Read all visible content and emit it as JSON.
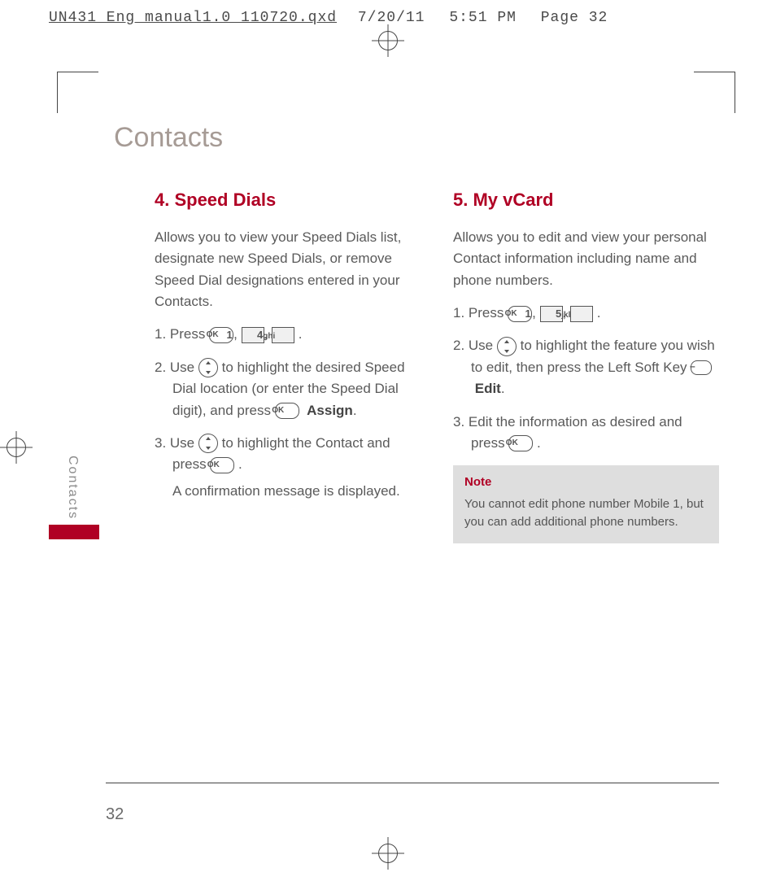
{
  "print_header": {
    "filename": "UN431_Eng_manual1.0_110720.qxd",
    "date": "7/20/11",
    "time": "5:51 PM",
    "page_label": "Page 32"
  },
  "chapter": "Contacts",
  "side_tab": "Contacts",
  "page_number": "32",
  "left": {
    "title": "4. Speed Dials",
    "intro": "Allows you to view your Speed Dials list, designate new Speed Dials, or remove Speed Dial designations entered in your Contacts.",
    "step1_pre": "1. Press ",
    "ok": "OK",
    "key1": "1",
    "key4": "4",
    "key4_sub": "ghi",
    "comma": ", ",
    "period": " .",
    "step2_pre": "2. Use ",
    "step2_post": " to highlight the desired Speed Dial location (or enter the Speed Dial digit), and press ",
    "assign": "Assign",
    "step3_pre": "3. Use ",
    "step3_mid": " to highlight the Contact and press ",
    "step3_tail": " .",
    "step3_after": "A confirmation message is displayed."
  },
  "right": {
    "title": "5. My vCard",
    "intro": "Allows you to edit and view your personal Contact information including name and phone numbers.",
    "step1_pre": "1. Press ",
    "key5": "5",
    "key5_sub": "jkl",
    "step2_pre": "2. Use ",
    "step2_post": " to highlight the feature you wish to edit, then press the Left Soft Key ",
    "softkey": "–",
    "edit": "Edit",
    "step3_pre": "3. Edit the information as desired and press ",
    "note_label": "Note",
    "note_body": "You cannot edit phone number Mobile 1, but you can add additional phone numbers."
  }
}
